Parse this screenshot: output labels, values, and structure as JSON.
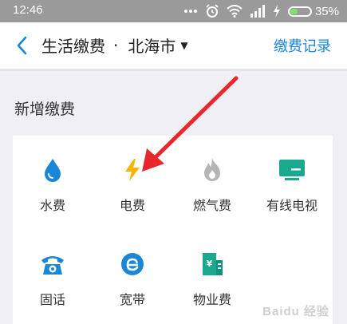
{
  "status_bar": {
    "time": "12:46",
    "battery_percent": "35%",
    "battery_level": 0.35
  },
  "header": {
    "title": "生活缴费",
    "separator": "·",
    "city": "北海市",
    "history_label": "缴费记录"
  },
  "section": {
    "title": "新增缴费"
  },
  "services": [
    {
      "label": "水费",
      "icon": "water-drop-icon",
      "color": "#1a86d8"
    },
    {
      "label": "电费",
      "icon": "lightning-icon",
      "color": "#f4b400"
    },
    {
      "label": "燃气费",
      "icon": "flame-icon",
      "color": "#b5b5b5"
    },
    {
      "label": "有线电视",
      "icon": "tv-icon",
      "color": "#1aa98f"
    },
    {
      "label": "固话",
      "icon": "telephone-icon",
      "color": "#1a86d8"
    },
    {
      "label": "宽带",
      "icon": "broadband-icon",
      "color": "#1a86d8"
    },
    {
      "label": "物业费",
      "icon": "building-icon",
      "color": "#1aa98f"
    }
  ],
  "watermark": "Baidu 经验",
  "colors": {
    "accent": "#1a86d8",
    "annotation_arrow": "#e8262b"
  }
}
